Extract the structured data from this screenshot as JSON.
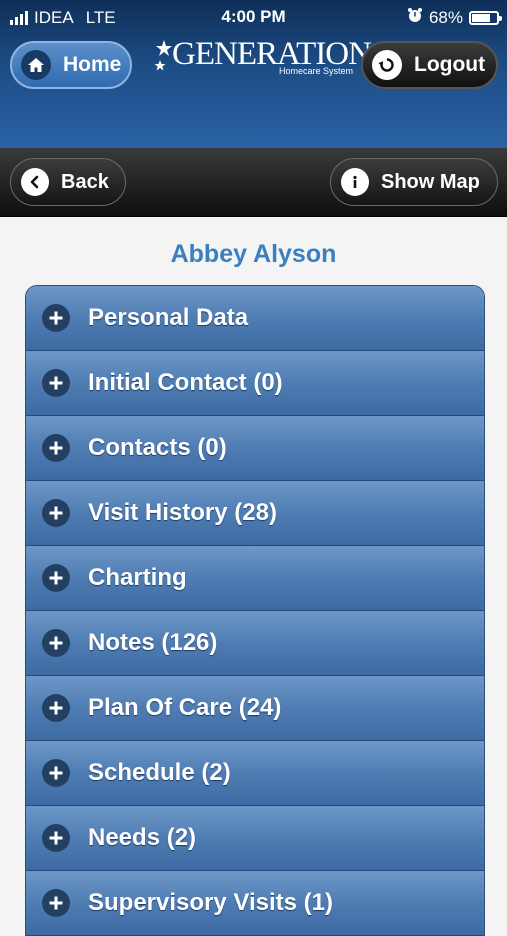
{
  "status_bar": {
    "carrier": "IDEA",
    "network": "LTE",
    "time": "4:00 PM",
    "battery_percent": "68%",
    "battery_level": 0.68
  },
  "header": {
    "home_label": "Home",
    "logout_label": "Logout",
    "logo_text": "GENERATIONS",
    "logo_subtitle": "Homecare System"
  },
  "nav": {
    "back_label": "Back",
    "show_map_label": "Show Map"
  },
  "patient_name": "Abbey Alyson",
  "sections": [
    {
      "label": "Personal Data"
    },
    {
      "label": "Initial Contact (0)"
    },
    {
      "label": "Contacts (0)"
    },
    {
      "label": "Visit History (28)"
    },
    {
      "label": "Charting"
    },
    {
      "label": "Notes (126)"
    },
    {
      "label": "Plan Of Care (24)"
    },
    {
      "label": "Schedule (2)"
    },
    {
      "label": "Needs (2)"
    },
    {
      "label": "Supervisory Visits (1)"
    }
  ],
  "icons": {
    "home": "home-icon",
    "logout": "logout-icon",
    "back": "chevron-left-icon",
    "info": "info-icon",
    "expand": "plus-icon"
  },
  "colors": {
    "header_blue": "#1d4d86",
    "title_blue": "#3c7fbf",
    "row_blue": "#4f7db3"
  }
}
